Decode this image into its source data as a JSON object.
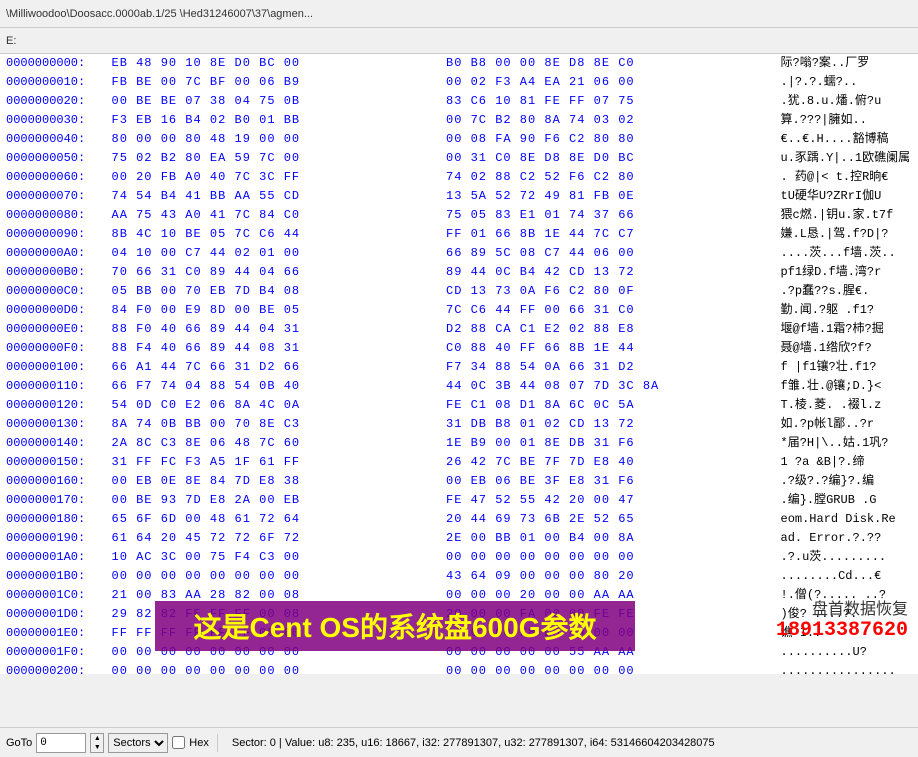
{
  "topbar": {
    "path": "\\Milliwoodoo\\Doosacc.0000ab.1/25  \\Hed31246007\\37\\agmen..."
  },
  "toolbar": {
    "label": "E:"
  },
  "hex_rows": [
    {
      "addr": "0000000000:",
      "hex1": "EB 48 90 10 8E D0 BC 00",
      "hex2": "B0 B8 00 00 8E D8 8E C0",
      "ascii": "际?嗡?案..厂罗"
    },
    {
      "addr": "0000000010:",
      "hex1": "FB BE 00 7C BF 00 06 B9",
      "hex2": "00 02 F3 A4 EA 21 06 00",
      "ascii": ".|?.?.蠕?.."
    },
    {
      "addr": "0000000020:",
      "hex1": "00 BE BE 07 38 04 75 0B",
      "hex2": "83 C6 10 81 FE FF 07 75",
      "ascii": ".犹.8.u.燔.俯?u"
    },
    {
      "addr": "0000000030:",
      "hex1": "F3 EB 16 B4 02 B0 01 BB",
      "hex2": "00 7C B2 80 8A 74 03 02",
      "ascii": "算.???|臃如.."
    },
    {
      "addr": "0000000040:",
      "hex1": "80 00 00 80 48 19 00 00",
      "hex2": "00 08 FA 90 F6 C2 80 80",
      "ascii": "€..€.H....豁博稿"
    },
    {
      "addr": "0000000050:",
      "hex1": "75 02 B2 80 EA 59 7C 00",
      "hex2": "00 31 C0 8E D8 8E D0 BC",
      "ascii": "u.豕踽.Y|..1欧礁阑属"
    },
    {
      "addr": "0000000060:",
      "hex1": "00 20 FB A0 40 7C 3C FF",
      "hex2": "74 02 88 C2 52 F6 C2 80",
      "ascii": ". 药@|< t.控R晌€"
    },
    {
      "addr": "0000000070:",
      "hex1": "74 54 B4 41 BB AA 55 CD",
      "hex2": "13 5A 52 72 49 81 FB 0E",
      "ascii": "tU硬华U?ZRrI伽U"
    },
    {
      "addr": "0000000080:",
      "hex1": "AA 75 43 A0 41 7C 84 C0",
      "hex2": "75 05 83 E1 01 74 37 66",
      "ascii": "猥c燃.|钥u.家.t7f"
    },
    {
      "addr": "0000000090:",
      "hex1": "8B 4C 10 BE 05 7C C6 44",
      "hex2": "FF 01 66 8B 1E 44 7C C7",
      "ascii": "嫌.L恳.|驾.f?D|?"
    },
    {
      "addr": "00000000A0:",
      "hex1": "04 10 00 C7 44 02 01 00",
      "hex2": "66 89 5C 08 C7 44 06 00",
      "ascii": "....茨...f墙.茨.."
    },
    {
      "addr": "00000000B0:",
      "hex1": "70 66 31 C0 89 44 04 66",
      "hex2": "89 44 0C B4 42 CD 13 72",
      "ascii": "pf1绿D.f墙.湾?r"
    },
    {
      "addr": "00000000C0:",
      "hex1": "05 BB 00 70 EB 7D B4 08",
      "hex2": "CD 13 73 0A F6 C2 80 0F",
      "ascii": ".?p蠢??s.腥€."
    },
    {
      "addr": "00000000D0:",
      "hex1": "84 F0 00 E9 8D 00 BE 05",
      "hex2": "7C C6 44 FF 00 66 31 C0",
      "ascii": "勤.闻.?躯 .f1?"
    },
    {
      "addr": "00000000E0:",
      "hex1": "88 F0 40 66 89 44 04 31",
      "hex2": "D2 88 CA C1 E2 02 88 E8",
      "ascii": "堰@f墙.1霜?柿?掘"
    },
    {
      "addr": "00000000F0:",
      "hex1": "88 F4 40 66 89 44 08 31",
      "hex2": "C0 88 40 FF 66 8B 1E 44",
      "ascii": "聂@墙.1绺欣?f?"
    },
    {
      "addr": "0000000100:",
      "hex1": "66 A1 44 7C 66 31 D2 66",
      "hex2": "F7 34 88 54 0A 66 31 D2",
      "ascii": "f  |f1镶?壮.f1?"
    },
    {
      "addr": "0000000110:",
      "hex1": "66 F7 74 04 88 54 0B 40",
      "hex2": "44 0C 3B 44 08 07 7D 3C 8A",
      "ascii": "f雏.壮.@镶;D.}<"
    },
    {
      "addr": "0000000120:",
      "hex1": "54 0D C0 E2 06 8A 4C 0A",
      "hex2": "FE C1 08 D1 8A 6C 0C 5A",
      "ascii": "T.棱.菱. .裰l.z"
    },
    {
      "addr": "0000000130:",
      "hex1": "8A 74 0B BB 00 70 8E C3",
      "hex2": "31 DB B8 01 02 CD 13 72",
      "ascii": "如.?p帐l鄙..?r"
    },
    {
      "addr": "0000000140:",
      "hex1": "2A 8C C3 8E 06 48 7C 60",
      "hex2": "1E B9 00 01 8E DB 31 F6",
      "ascii": "*届?H|\\..姑.1巩?"
    },
    {
      "addr": "0000000150:",
      "hex1": "31 FF FC F3 A5 1F 61 FF",
      "hex2": "26 42 7C BE 7F 7D E8 40",
      "ascii": "1   ?a &B|?.缔"
    },
    {
      "addr": "0000000160:",
      "hex1": "00 EB 0E 8E 84 7D E8 38",
      "hex2": "00 EB 06 BE 3F E8 31 F6",
      "ascii": ".?级?.?编}?.编"
    },
    {
      "addr": "0000000170:",
      "hex1": "00 BE 93 7D E8 2A 00 EB",
      "hex2": "FE 47 52 55 42 20 00 47",
      "ascii": ".编}.膛GRUB .G"
    },
    {
      "addr": "0000000180:",
      "hex1": "65 6F 6D 00 48 61 72 64",
      "hex2": "20 44 69 73 6B 2E 52 65",
      "ascii": "eom.Hard Disk.Re"
    },
    {
      "addr": "0000000190:",
      "hex1": "61 64 20 45 72 72 6F 72",
      "hex2": "2E 00 BB 01 00 B4 00 8A",
      "ascii": "ad. Error.?.??"
    },
    {
      "addr": "00000001A0:",
      "hex1": "10 AC 3C 00 75 F4 C3 00",
      "hex2": "00 00 00 00 00 00 00 00",
      "ascii": ".?.u茨........."
    },
    {
      "addr": "00000001B0:",
      "hex1": "00 00 00 00 00 00 00 00",
      "hex2": "43 64 09 00 00 00 80 20",
      "ascii": "........Cd...€"
    },
    {
      "addr": "00000001C0:",
      "hex1": "21 00 83 AA 28 82 00 08",
      "hex2": "00 00 00 20 00 00 AA AA",
      "ascii": "!.僧(?..... ..?"
    },
    {
      "addr": "00000001D0:",
      "hex1": "29 82 82 FE FF FF 00 08",
      "hex2": "20 00 00 FA 00 00 FE FE",
      "ascii": ")俊?     ....?."
    },
    {
      "addr": "00000001E0:",
      "hex1": "FF FF FF FF FF FF 00 00",
      "hex2": "1A 01 00 F8 E5 49 00 00",
      "ascii": "         谯    I.."
    },
    {
      "addr": "00000001F0:",
      "hex1": "00 00 00 00 00 00 00 00",
      "hex2": "00 00 00 00 00 55 AA AA",
      "ascii": "..........U?"
    },
    {
      "addr": "0000000200:",
      "hex1": "00 00 00 00 00 00 00 00",
      "hex2": "00 00 00 00 00 00 00 00",
      "ascii": "................"
    },
    {
      "addr": "0000000210:",
      "hex1": "00 00 00 00 00 00 00 00",
      "hex2": "00 00 00 00 00 00 00 00",
      "ascii": "................"
    },
    {
      "addr": "0000000220:",
      "hex1": "00 00 00 00 00 00 00 00",
      "hex2": "00 00 00 00 00 00 00 00",
      "ascii": "................"
    }
  ],
  "highlight": {
    "text": "这是Cent OS的系统盘600G参数"
  },
  "watermark": {
    "line1": "盘首数据恢复",
    "line2": "18913387620"
  },
  "statusbar": {
    "goto_label": "GoTo",
    "goto_value": "0",
    "sectors_label": "Sectors",
    "hex_label": "Hex",
    "status_text": "Sector: 0 | Value: u8: 235, u16: 18667, i32: 277891307, u32: 277891307, i64: 53146604203428075"
  }
}
